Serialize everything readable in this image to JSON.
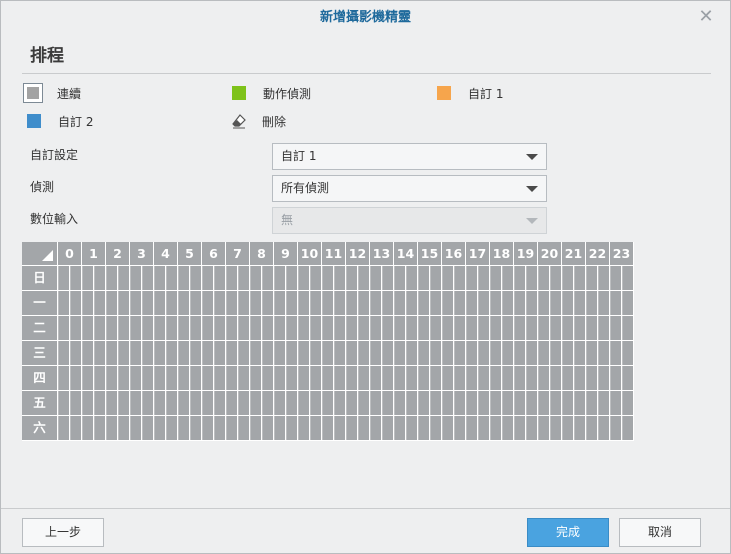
{
  "dialog": {
    "title": "新增攝影機精靈",
    "close_glyph": "✕"
  },
  "section_title": "排程",
  "legend": [
    {
      "label": "連續",
      "color": "#a3a3a3",
      "icon": "continuous-swatch"
    },
    {
      "label": "動作偵測",
      "color": "#7ec21a",
      "icon": "motion-swatch"
    },
    {
      "label": "自訂 1",
      "color": "#f6a54c",
      "icon": "custom1-swatch"
    },
    {
      "label": "自訂 2",
      "color": "#3f8dcb",
      "icon": "custom2-swatch"
    },
    {
      "label": "刪除",
      "icon": "eraser-icon"
    }
  ],
  "form": {
    "custom_settings": {
      "label": "自訂設定",
      "value": "自訂 1"
    },
    "detection": {
      "label": "偵測",
      "value": "所有偵測"
    },
    "digital_input": {
      "label": "數位輸入",
      "value": "無",
      "disabled": true
    }
  },
  "schedule": {
    "hours": [
      "0",
      "1",
      "2",
      "3",
      "4",
      "5",
      "6",
      "7",
      "8",
      "9",
      "10",
      "11",
      "12",
      "13",
      "14",
      "15",
      "16",
      "17",
      "18",
      "19",
      "20",
      "21",
      "22",
      "23"
    ],
    "days": [
      "日",
      "一",
      "二",
      "三",
      "四",
      "五",
      "六"
    ],
    "fill_color": "#a3a6a9"
  },
  "footer": {
    "back_label": "上一步",
    "finish_label": "完成",
    "cancel_label": "取消"
  }
}
